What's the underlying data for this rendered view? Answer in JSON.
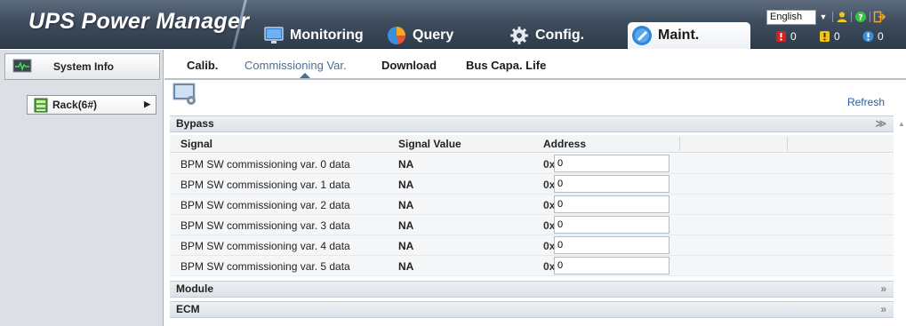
{
  "app": {
    "title": "UPS Power Manager"
  },
  "main_tabs": [
    {
      "label": "Monitoring",
      "icon": "monitor-icon",
      "active": false
    },
    {
      "label": "Query",
      "icon": "pie-chart-icon",
      "active": false
    },
    {
      "label": "Config.",
      "icon": "gear-icon",
      "active": false
    },
    {
      "label": "Maint.",
      "icon": "maintenance-icon",
      "active": true
    }
  ],
  "header": {
    "language": {
      "selected": "English"
    },
    "alarms": {
      "critical": "0",
      "major": "0",
      "info": "0"
    },
    "colors": {
      "critical": "#d42020",
      "major": "#f0c419",
      "info": "#3b8fd9"
    }
  },
  "sidebar": {
    "header": "System Info",
    "items": [
      {
        "label": "Rack(6#)"
      }
    ]
  },
  "sub_tabs": [
    {
      "label": "Calib.",
      "active": false
    },
    {
      "label": "Commissioning Var.",
      "active": true
    },
    {
      "label": "Download",
      "active": false
    },
    {
      "label": "Bus Capa. Life",
      "active": false
    }
  ],
  "content": {
    "refresh_label": "Refresh",
    "sections": [
      {
        "title": "Bypass",
        "expanded": true
      },
      {
        "title": "Module",
        "expanded": false
      },
      {
        "title": "ECM",
        "expanded": false
      }
    ],
    "table": {
      "columns": [
        "Signal",
        "Signal Value",
        "Address"
      ],
      "address_prefix": "0x",
      "rows": [
        {
          "signal": "BPM SW commissioning var. 0 data",
          "value": "NA",
          "address": "0"
        },
        {
          "signal": "BPM SW commissioning var. 1 data",
          "value": "NA",
          "address": "0"
        },
        {
          "signal": "BPM SW commissioning var. 2 data",
          "value": "NA",
          "address": "0"
        },
        {
          "signal": "BPM SW commissioning var. 3 data",
          "value": "NA",
          "address": "0"
        },
        {
          "signal": "BPM SW commissioning var. 4 data",
          "value": "NA",
          "address": "0"
        },
        {
          "signal": "BPM SW commissioning var. 5 data",
          "value": "NA",
          "address": "0"
        }
      ]
    }
  }
}
